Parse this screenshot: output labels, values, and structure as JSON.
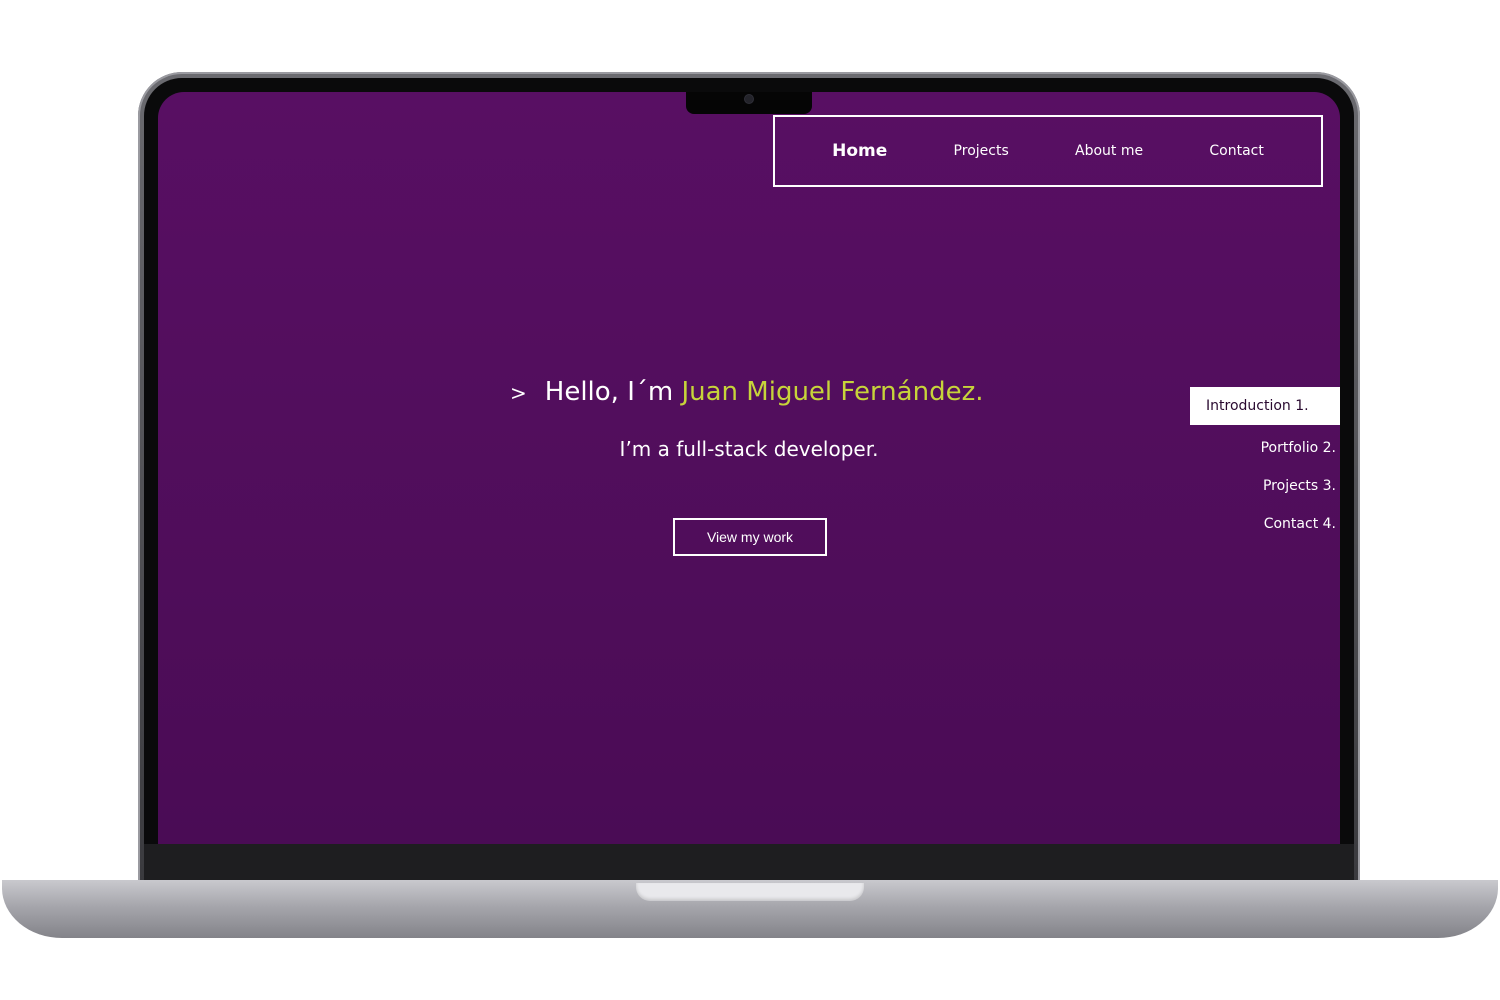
{
  "nav": {
    "items": [
      {
        "label": "Home",
        "active": true
      },
      {
        "label": "Projects",
        "active": false
      },
      {
        "label": "About me",
        "active": false
      },
      {
        "label": "Contact",
        "active": false
      }
    ]
  },
  "hero": {
    "prompt_symbol": ">",
    "greeting": "Hello, I´m ",
    "name": "Juan Miguel Fernández.",
    "subtitle": "I’m a full-stack developer.",
    "cta_label": "View my work"
  },
  "side_nav": {
    "items": [
      {
        "label": "Introduction 1.",
        "active": true
      },
      {
        "label": "Portfolio 2.",
        "active": false
      },
      {
        "label": "Projects 3.",
        "active": false
      },
      {
        "label": "Contact 4.",
        "active": false
      }
    ]
  },
  "colors": {
    "background_top": "#580f63",
    "background_bottom": "#4a0c55",
    "accent_name": "#c7d43a",
    "text": "#ffffff"
  }
}
